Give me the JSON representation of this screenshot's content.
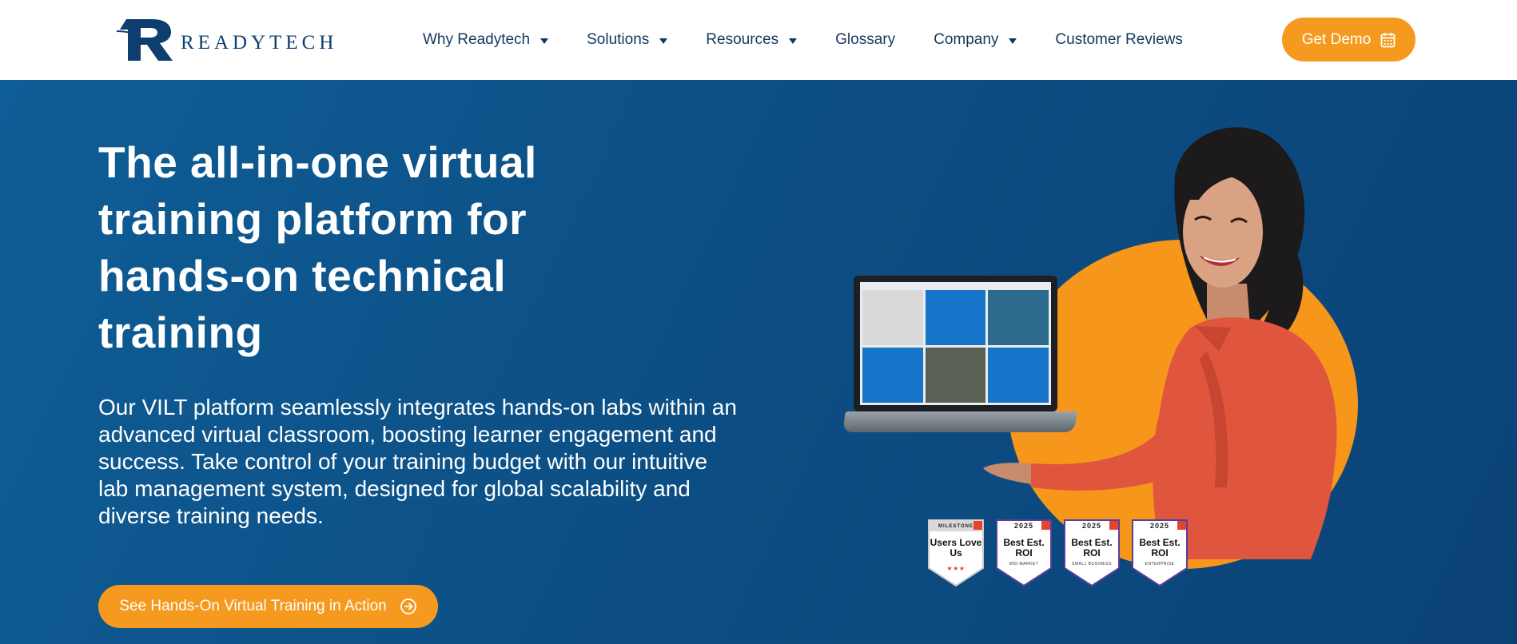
{
  "brand": {
    "name": "READYTECH",
    "primary_color": "#0d3e6e",
    "accent_color": "#f59a1e",
    "hero_color": "#0c4f85"
  },
  "nav": {
    "items": [
      {
        "label": "Why Readytech",
        "dropdown": true
      },
      {
        "label": "Solutions",
        "dropdown": true
      },
      {
        "label": "Resources",
        "dropdown": true
      },
      {
        "label": "Glossary",
        "dropdown": false
      },
      {
        "label": "Company",
        "dropdown": true
      },
      {
        "label": "Customer Reviews",
        "dropdown": false
      }
    ],
    "demo_label": "Get Demo",
    "demo_icon": "calendar-icon"
  },
  "hero": {
    "title": "The all-in-one virtual training platform for hands-on technical training",
    "description": "Our VILT platform seamlessly integrates hands-on labs within an advanced virtual classroom, boosting learner engagement and success. Take control of your training budget with our intuitive lab management system, designed for global scalability and diverse training needs.",
    "cta_label": "See Hands-On Virtual Training in Action",
    "cta_icon": "arrow-circle-right-icon"
  },
  "badges": [
    {
      "top": "MILESTONE",
      "main": "Users Love Us",
      "sub": "",
      "stars": 3
    },
    {
      "top": "2025",
      "main": "Best Est. ROI",
      "sub": "MID-MARKET"
    },
    {
      "top": "2025",
      "main": "Best Est. ROI",
      "sub": "SMALL BUSINESS"
    },
    {
      "top": "2025",
      "main": "Best Est. ROI",
      "sub": "ENTERPRISE"
    }
  ]
}
